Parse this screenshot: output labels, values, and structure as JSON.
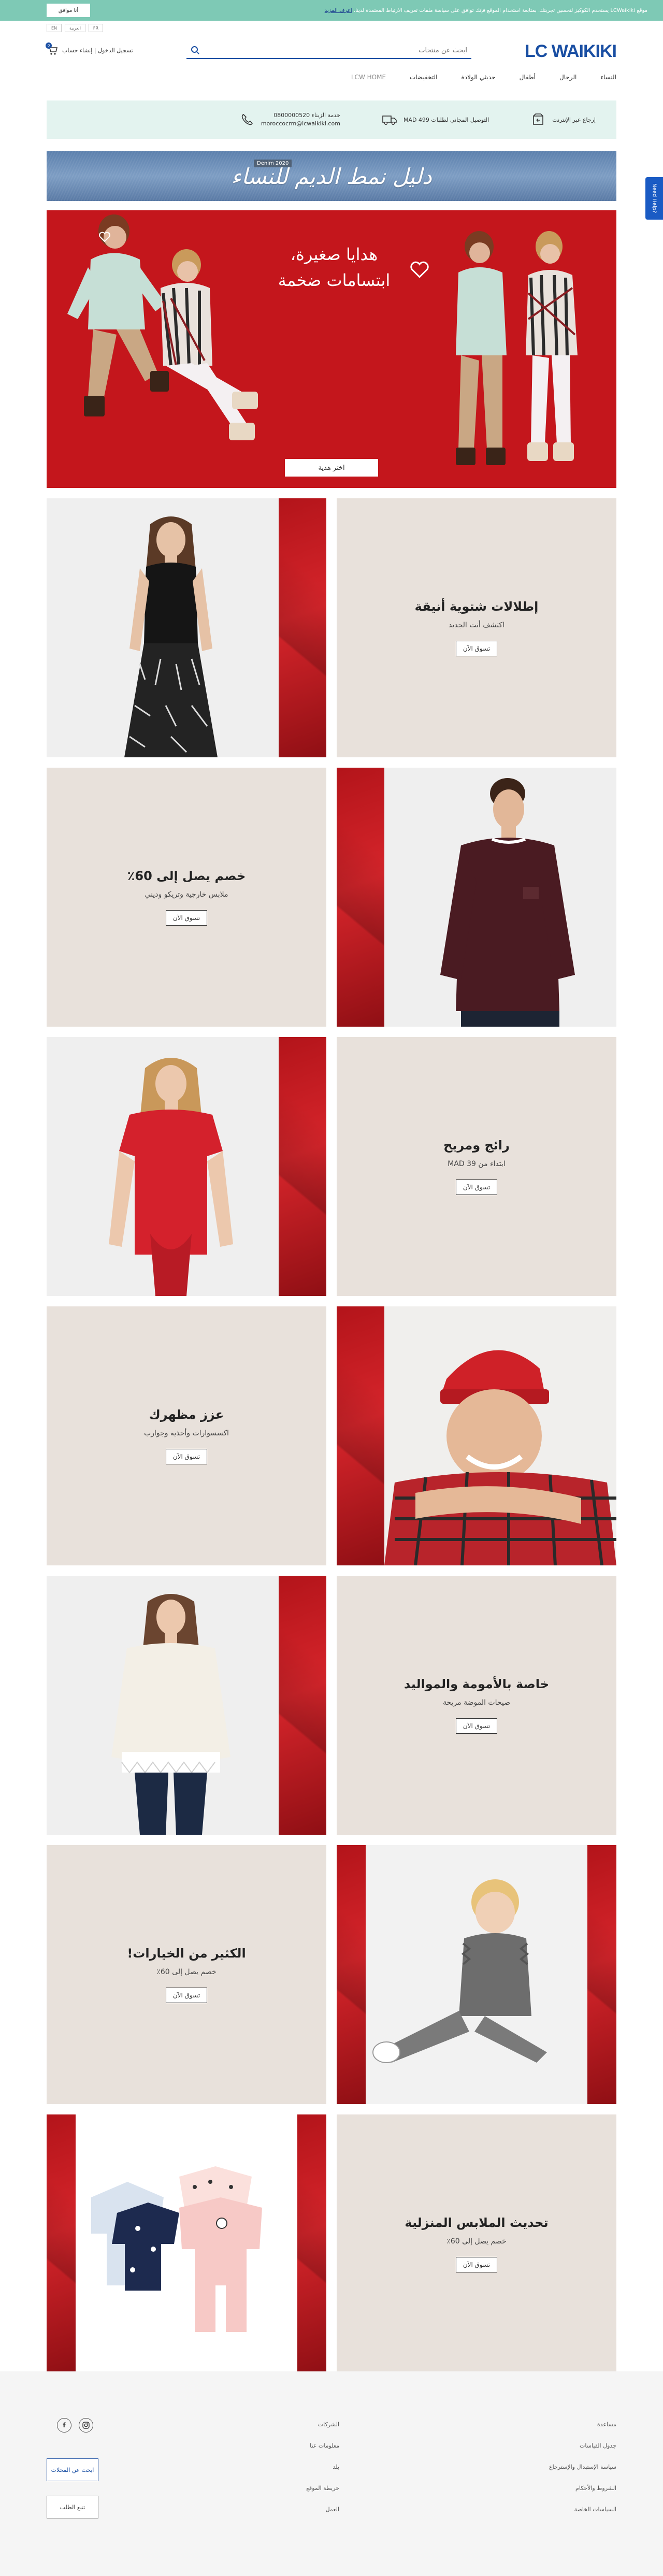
{
  "cookie_bar": {
    "accept_label": "أنا موافق",
    "message": "موقع LCWaikiki يستخدم الكوكيز لتحسين تجربتك. بمتابعة استخدام الموقع فإنك توافق على سياسة ملفات تعريف الارتباط المعتمدة لدينا.",
    "link_text": "اعرف المزيد"
  },
  "language_chips": [
    "EN",
    "العربية",
    "FR"
  ],
  "header": {
    "logo": "LC WAIKIKI",
    "search_placeholder": "ابحث عن منتجات",
    "login_label": "تسجيل الدخول | إنشاء حساب",
    "cart_count": "0"
  },
  "nav": {
    "items": [
      "النساء",
      "الرجال",
      "أطفال",
      "حديثي الولادة",
      "التخفيضات",
      "LCW HOME"
    ]
  },
  "info_strip": {
    "returns": "إرجاع عبر الإنترنت",
    "shipping": "التوصيل المجاني لطلبات 499 MAD",
    "service_title": "خدمة الزبناء 0800000520",
    "service_email": "moroccocrm@lcwaikiki.com"
  },
  "denim_banner": {
    "title": "دليل نمط الديم للنساء",
    "tag": "Denim 2020"
  },
  "side_tab": "Need Help?",
  "hero": {
    "title_line1": "هدايا صغيرة،",
    "title_line2": "ابتسامات ضخمة",
    "button": "اختر هدية"
  },
  "tiles": [
    {
      "title": "إطلالات شتوية أنيقة",
      "sub": "اكتشف أنت الجديد",
      "button": "تسوق الآن"
    },
    {
      "title": "خصم يصل إلى 60٪",
      "sub": "ملابس خارجية وتريكو وديني",
      "button": "تسوق الآن"
    },
    {
      "title": "رائج ومريح",
      "sub": "ابتداء من 39 MAD",
      "button": "تسوق الآن"
    },
    {
      "title": "عزز مظهرك",
      "sub": "اكسسوارات وأحذية وجوارب",
      "button": "تسوق الآن"
    },
    {
      "title": "خاصة بالأمومة والمواليد",
      "sub": "صيحات الموضة مريحة",
      "button": "تسوق الآن"
    },
    {
      "title": "الكثير من الخيارات!",
      "sub": "خصم يصل إلى 60٪",
      "button": "تسوق الآن"
    },
    {
      "title": "تحديث الملابس المنزلية",
      "sub": "خصم يصل إلى 60٪",
      "button": "تسوق الآن"
    }
  ],
  "footer": {
    "col1": [
      "مساعدة",
      "جدول القياسات",
      "سياسة الإستبدال والإسترجاع",
      "الشروط والأحكام",
      "السياسات الخاصة"
    ],
    "col2": [
      "الشركات",
      "معلومات عنا",
      "بلد",
      "خريطة الموقع",
      "العمل"
    ],
    "store_button": "ابحث عن المحلات",
    "track_button": "تتبع الطلب",
    "social": [
      "f",
      "ig"
    ]
  },
  "colors": {
    "brand_blue": "#1a4fa3",
    "cookie_teal": "#7ec9b5",
    "hero_red": "#c4161c",
    "tile_beige": "#e8e1db",
    "info_mint": "#e3f3ef"
  }
}
